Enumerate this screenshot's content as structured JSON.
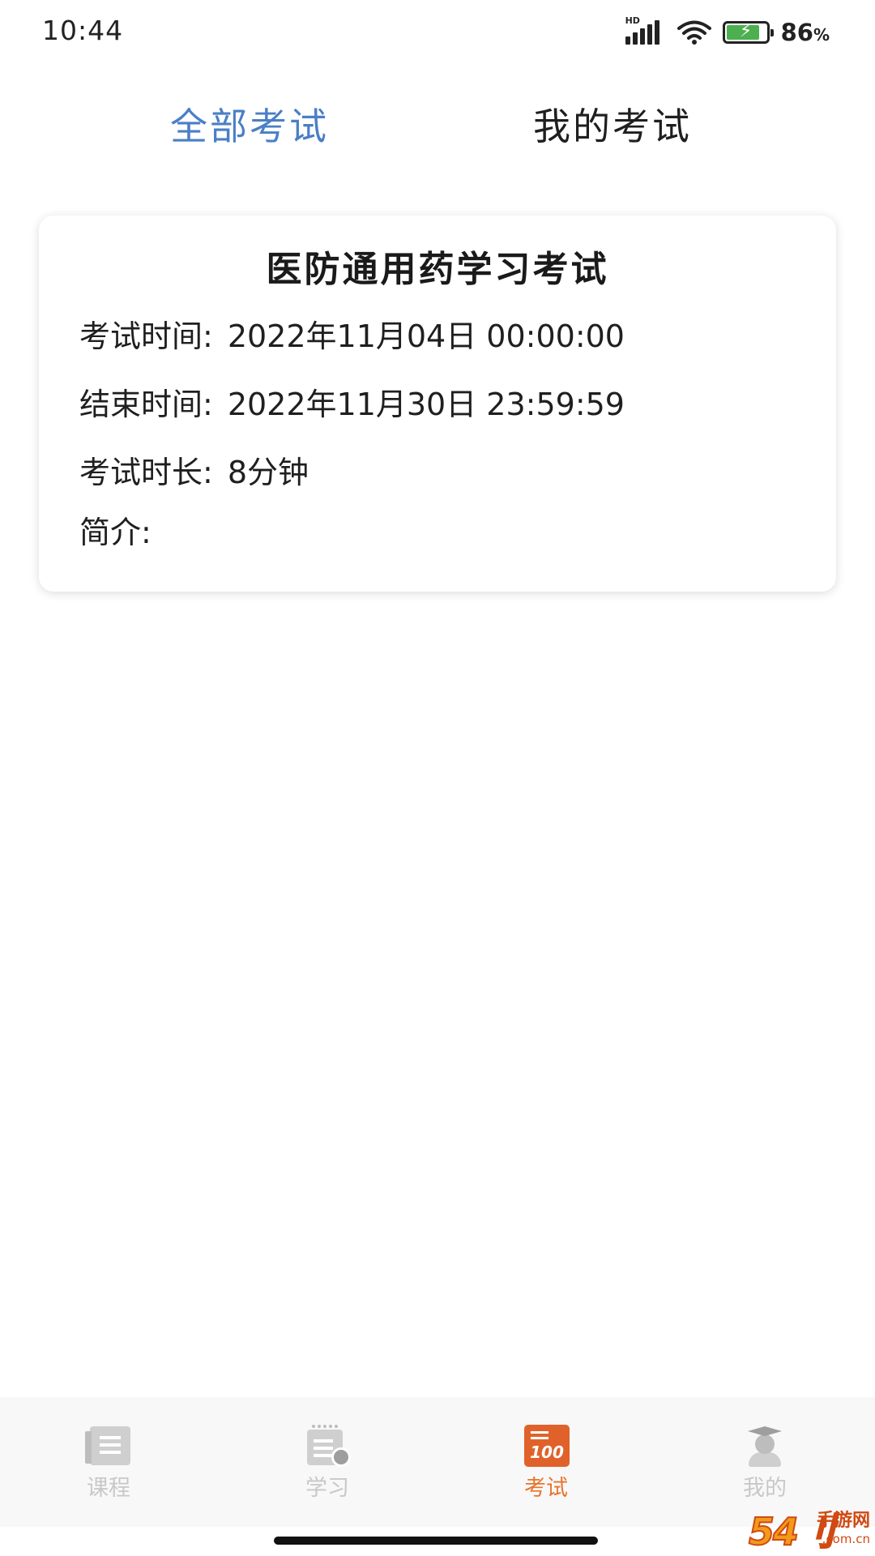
{
  "status_bar": {
    "time": "10:44",
    "network": "HD",
    "battery_percent": "86",
    "battery_unit": "%",
    "battery_level": 0.86,
    "battery_color": "#4caf50"
  },
  "top_tabs": [
    {
      "label": "全部考试",
      "active": true
    },
    {
      "label": "我的考试",
      "active": false
    }
  ],
  "exam_card": {
    "title": "医防通用药学习考试",
    "start_label": "考试时间:",
    "start_value": "2022年11月04日 00:00:00",
    "end_label": "结束时间:",
    "end_value": "2022年11月30日 23:59:59",
    "duration_label": "考试时长:",
    "duration_value": "8分钟",
    "intro_label": "简介:"
  },
  "bottom_nav": [
    {
      "label": "课程",
      "icon": "book-icon",
      "active": false
    },
    {
      "label": "学习",
      "icon": "study-calendar-icon",
      "active": false
    },
    {
      "label": "考试",
      "icon": "exam-score-100-icon",
      "active": true,
      "icon_text": "100"
    },
    {
      "label": "我的",
      "icon": "graduate-avatar-icon",
      "active": false
    }
  ],
  "colors": {
    "active_tab": "#4a7fc6",
    "active_nav": "#e8742c",
    "inactive_nav": "#c8c8c8"
  },
  "watermark": {
    "logo": "54刂",
    "text": "手游网",
    "domain": ".com.cn"
  }
}
